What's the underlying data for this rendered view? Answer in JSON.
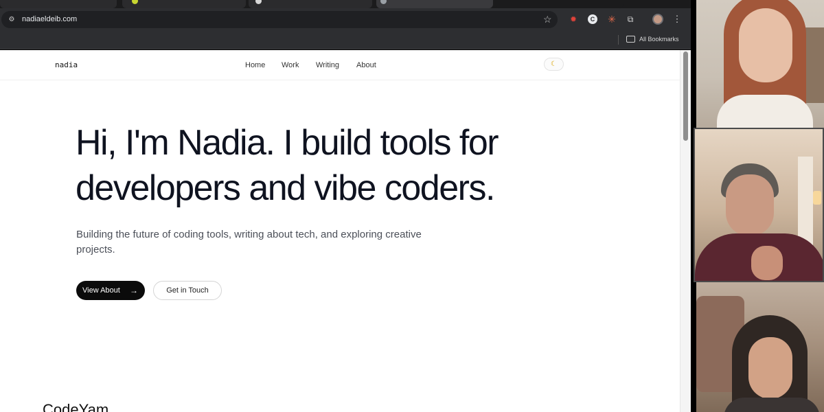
{
  "browser": {
    "url": "nadiaeldeib.com",
    "bookmarks_label": "All Bookmarks"
  },
  "site": {
    "logo": "nadia",
    "nav": [
      "Home",
      "Work",
      "Writing",
      "About"
    ],
    "theme_icon": "moon-icon",
    "hero_title": "Hi, I'm Nadia. I build tools for developers and vibe coders.",
    "hero_subtitle": "Building the future of coding tools, writing about tech, and exploring creative projects.",
    "primary_button": "View About",
    "secondary_button": "Get in Touch",
    "section_title": "CodeYam"
  },
  "colors": {
    "chrome_dark": "#2d2e31",
    "page_bg": "#ffffff",
    "text_primary": "#0f1320",
    "button_bg": "#0b0b0b"
  }
}
